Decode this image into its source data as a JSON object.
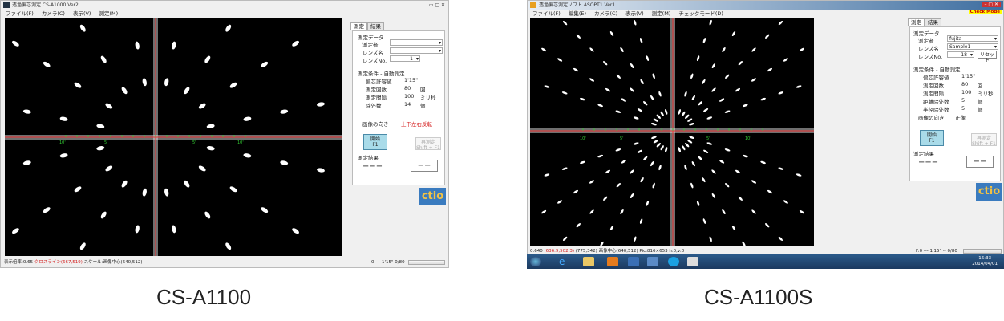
{
  "left": {
    "title": "透過偏芯測定 CS-A1000 Ver2",
    "menu": [
      "ファイル(F)",
      "カメラ(C)",
      "表示(V)",
      "測定(M)"
    ],
    "tabs": [
      "測定",
      "結果"
    ],
    "measure_data": {
      "heading": "測定データ",
      "operator_label": "測定者",
      "operator_value": "",
      "lens_label": "レンズ名",
      "lens_value": "",
      "lensno_label": "レンズNo.",
      "lensno_value": "1"
    },
    "conditions": {
      "heading": "測定条件 - 自動測定",
      "rows": [
        [
          "偏芯許容値",
          "1'15\"",
          ""
        ],
        [
          "測定回数",
          "80",
          "回"
        ],
        [
          "測定間隔",
          "100",
          "ミリ秒"
        ],
        [
          "除外数",
          "14",
          "個"
        ]
      ],
      "orient_label": "画像の向き",
      "orient_value": "上下左右反転"
    },
    "start_btn": "開始",
    "start_key": "F1",
    "remeasure_btn": "再測定",
    "remeasure_key": "Shift + F1",
    "result": {
      "heading": "測定結果",
      "value1": "−−−",
      "value2": "−−"
    },
    "status": {
      "scale": "表示倍率:0.65",
      "cross": "クロスライン(667,519)",
      "center": "スケール:画像中心(640,512)",
      "right": "0 --- 1'15\" 0/80"
    },
    "scale_labels": [
      "10'",
      "5'",
      "5'",
      "10'"
    ],
    "logo": "ctio"
  },
  "right": {
    "title": "透過偏芯測定ソフト ASOPT1 Ver1",
    "menu": [
      "ファイル(F)",
      "編集(E)",
      "カメラ(C)",
      "表示(V)",
      "測定(M)",
      "チェックモード(D)"
    ],
    "check_mode": "Check Mode",
    "tabs": [
      "測定",
      "結果"
    ],
    "measure_data": {
      "heading": "測定データ",
      "operator_label": "測定者",
      "operator_value": "fujita",
      "lens_label": "レンズ名",
      "lens_value": "Sample1",
      "lensno_label": "レンズNo.",
      "lensno_value": "18",
      "reset": "リセット"
    },
    "conditions": {
      "heading": "測定条件 - 自動測定",
      "rows": [
        [
          "偏芯許容値",
          "1'15\"",
          ""
        ],
        [
          "測定回数",
          "80",
          "回"
        ],
        [
          "測定間隔",
          "100",
          "ミリ秒"
        ],
        [
          "距離除外数",
          "5",
          "個"
        ],
        [
          "半径除外数",
          "5",
          "個"
        ]
      ],
      "orient_label": "画像の向き",
      "orient_value": "正像"
    },
    "start_btn": "開始",
    "start_key": "F1",
    "remeasure_btn": "再測定",
    "remeasure_key": "Shift + F1",
    "result": {
      "heading": "測定結果",
      "value1": "−−−",
      "value2": "−−"
    },
    "status": {
      "scale": "0.640",
      "cross": "(636.9,502.3)",
      "pos": "(775,342)",
      "center": "画像中心(640,512)",
      "pic": "Pic:816×653",
      "hv": "h:0,v:0",
      "right": "F:0 --- 1'15\" -- 0/80"
    },
    "scale_labels": [
      "10'",
      "5'",
      "5'",
      "10'"
    ],
    "clock_time": "16:33",
    "clock_date": "2014/04/01",
    "logo": "ctio"
  },
  "captions": [
    "CS-A1100",
    "CS-A1100S"
  ]
}
